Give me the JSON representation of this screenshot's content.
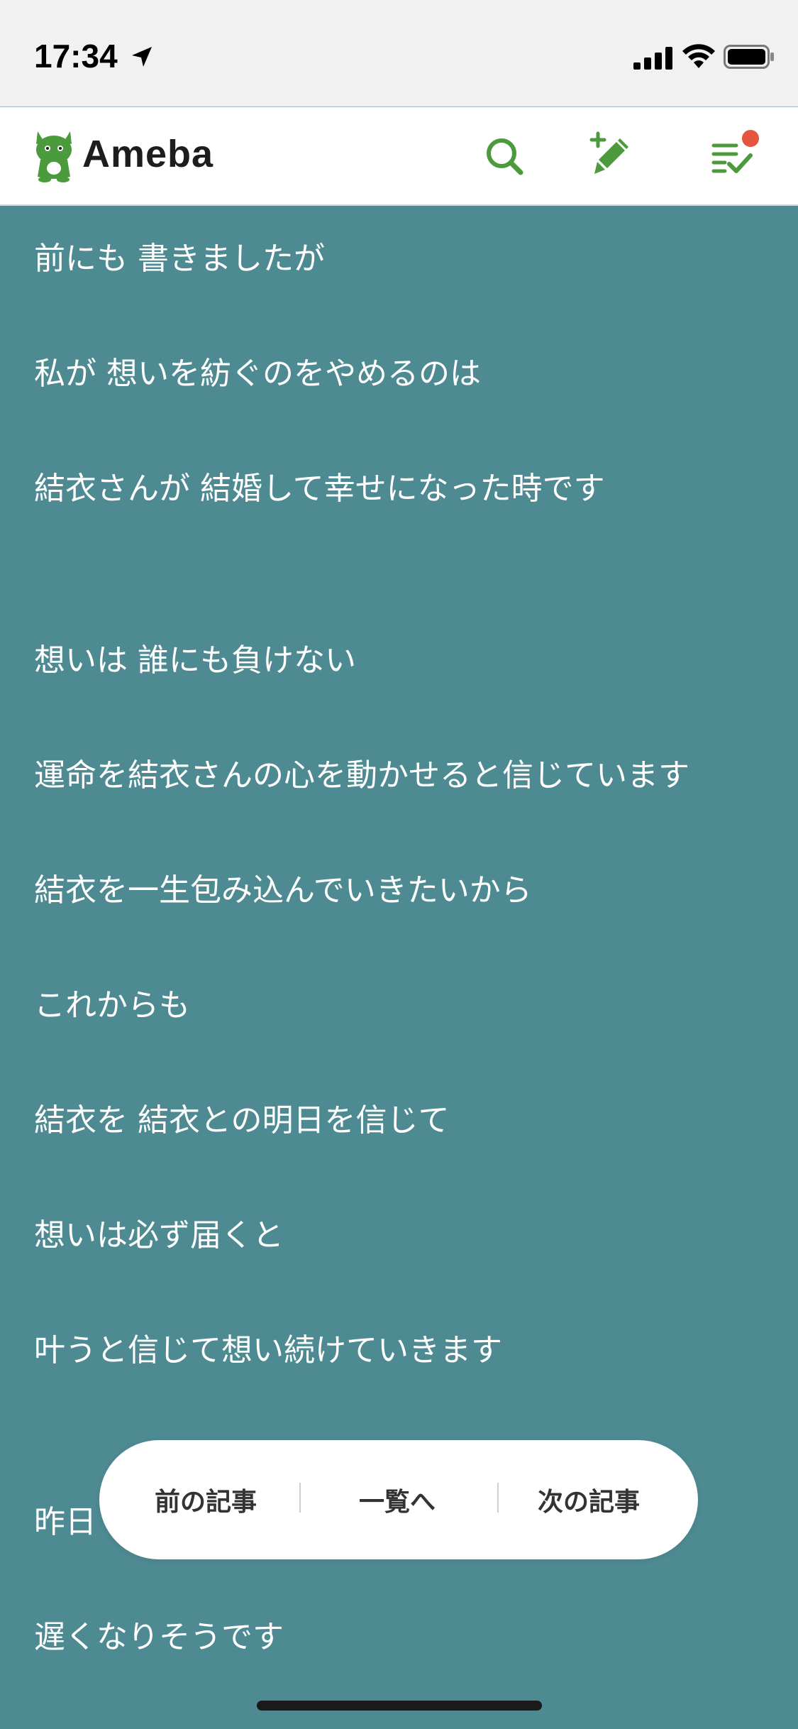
{
  "status_bar": {
    "time": "17:34"
  },
  "header": {
    "logo_text": "Ameba",
    "icons": [
      "search-icon",
      "write-icon",
      "news-feed-icon"
    ],
    "accent_color": "#4b9a3b",
    "notification_color": "#e4543f"
  },
  "article": {
    "background_color": "#4e8a92",
    "lines": [
      "前にも 書きましたが",
      "私が 想いを紡ぐのをやめるのは",
      "結衣さんが 結婚して幸せになった時です",
      "想いは 誰にも負けない",
      "運命を結衣さんの心を動かせると信じています",
      "結衣を一生包み込んでいきたいから",
      "これからも",
      "結衣を 結衣との明日を信じて",
      "想いは必ず届くと",
      "叶うと信じて想い続けていきます",
      "昨日",
      "遅くなりそうです"
    ]
  },
  "pager": {
    "prev_label": "前の記事",
    "list_label": "一覧へ",
    "next_label": "次の記事"
  }
}
